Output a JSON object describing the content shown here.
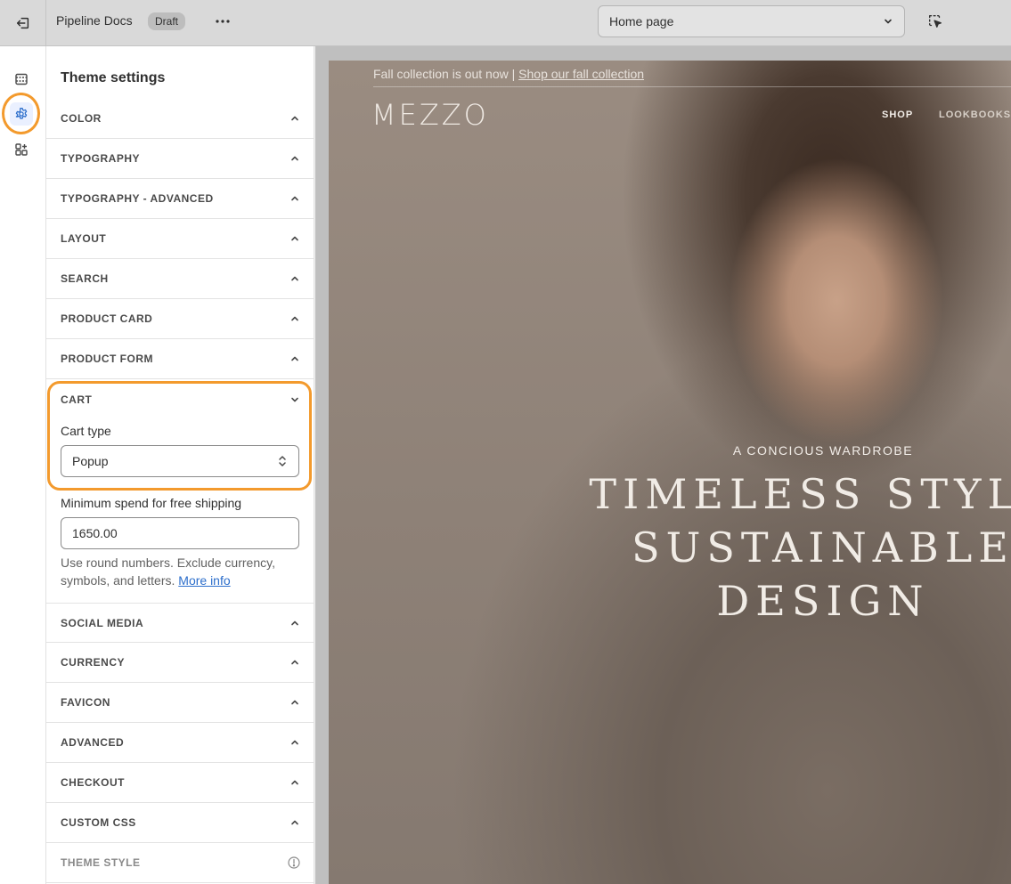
{
  "topbar": {
    "store_name": "Pipeline Docs",
    "status_badge": "Draft",
    "page_selector": "Home page"
  },
  "rail": {
    "icons": [
      "sections-icon",
      "gear-icon",
      "apps-icon"
    ],
    "active": "gear-icon"
  },
  "panel": {
    "title": "Theme settings",
    "sections_before": [
      "COLOR",
      "TYPOGRAPHY",
      "TYPOGRAPHY - ADVANCED",
      "LAYOUT",
      "SEARCH",
      "PRODUCT CARD",
      "PRODUCT FORM"
    ],
    "cart": {
      "title": "CART",
      "cart_type_label": "Cart type",
      "cart_type_value": "Popup",
      "min_spend_label": "Minimum spend for free shipping",
      "min_spend_value": "1650.00",
      "help_text": "Use round numbers. Exclude currency, symbols, and letters.",
      "help_link": "More info"
    },
    "sections_after": [
      "SOCIAL MEDIA",
      "CURRENCY",
      "FAVICON",
      "ADVANCED",
      "CHECKOUT",
      "CUSTOM CSS",
      "THEME STYLE"
    ]
  },
  "preview": {
    "announcement": "Fall collection is out now |",
    "announcement_link": "Shop our fall collection",
    "logo": "MEZZO",
    "nav": [
      "SHOP",
      "LOOKBOOKS"
    ],
    "kicker": "A CONCIOUS WARDROBE",
    "headline": [
      "TIMELESS STYLE",
      "SUSTAINABLE",
      "DESIGN"
    ]
  },
  "colors": {
    "highlight_ring": "#f39a2d",
    "link": "#2c6ecb"
  }
}
